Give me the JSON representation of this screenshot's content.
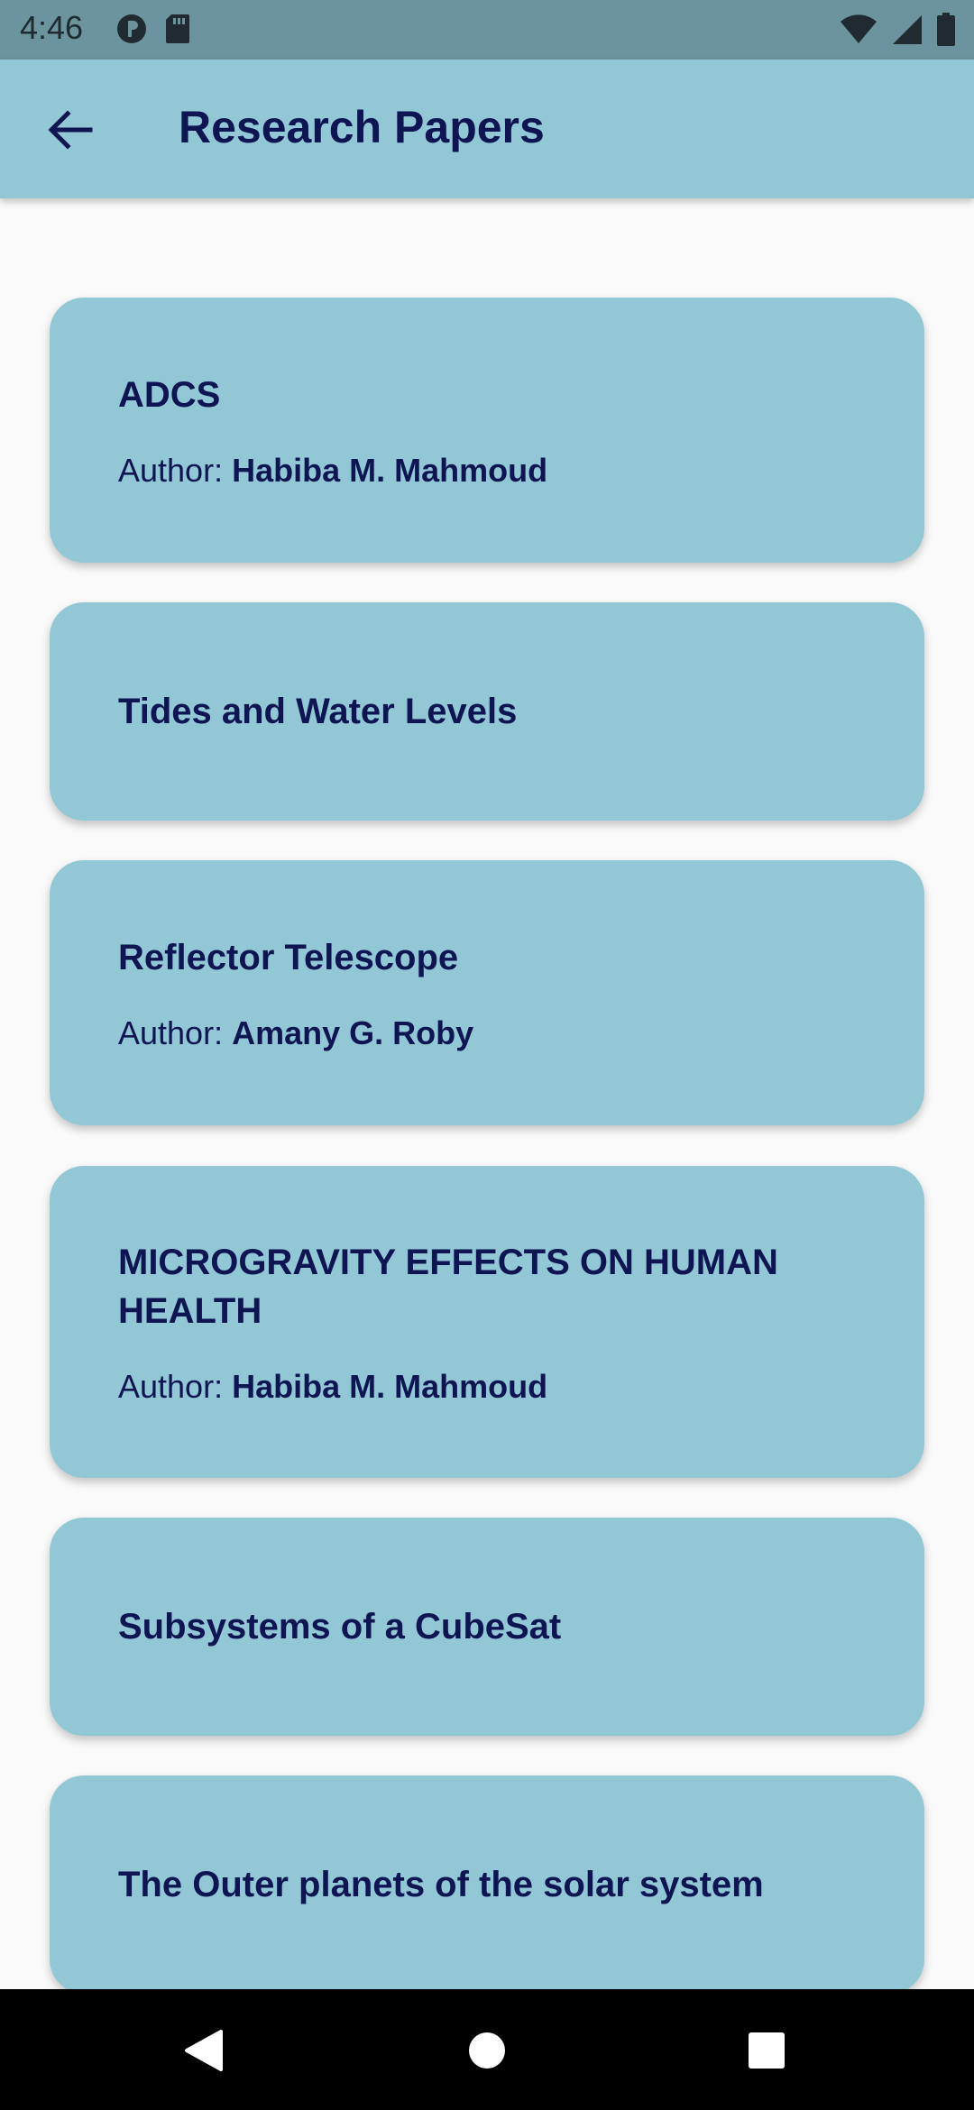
{
  "status_bar": {
    "time": "4:46",
    "icons_left": [
      "data-saver-icon",
      "sd-card-icon"
    ],
    "icons_right": [
      "wifi-icon",
      "signal-icon",
      "battery-icon"
    ]
  },
  "app_bar": {
    "back_icon": "arrow-back-icon",
    "title": "Research Papers"
  },
  "papers": [
    {
      "title": "ADCS",
      "author_label": "Author: ",
      "author": "Habiba M. Mahmoud"
    },
    {
      "title": "Tides and Water Levels"
    },
    {
      "title": "Reflector Telescope",
      "author_label": "Author: ",
      "author": "Amany G. Roby"
    },
    {
      "title": "MICROGRAVITY EFFECTS ON HUMAN HEALTH",
      "author_label": "Author: ",
      "author": "Habiba M. Mahmoud"
    },
    {
      "title": "Subsystems of a CubeSat"
    },
    {
      "title": "The Outer planets of the solar system"
    }
  ],
  "nav_bar": {
    "buttons": [
      "back-triangle-icon",
      "home-circle-icon",
      "recents-square-icon"
    ]
  },
  "colors": {
    "app_bar": "#92c8d6",
    "card": "#92c8d6",
    "text": "#0f1452",
    "status_bar": "#6b949e",
    "background": "#fafafa"
  }
}
